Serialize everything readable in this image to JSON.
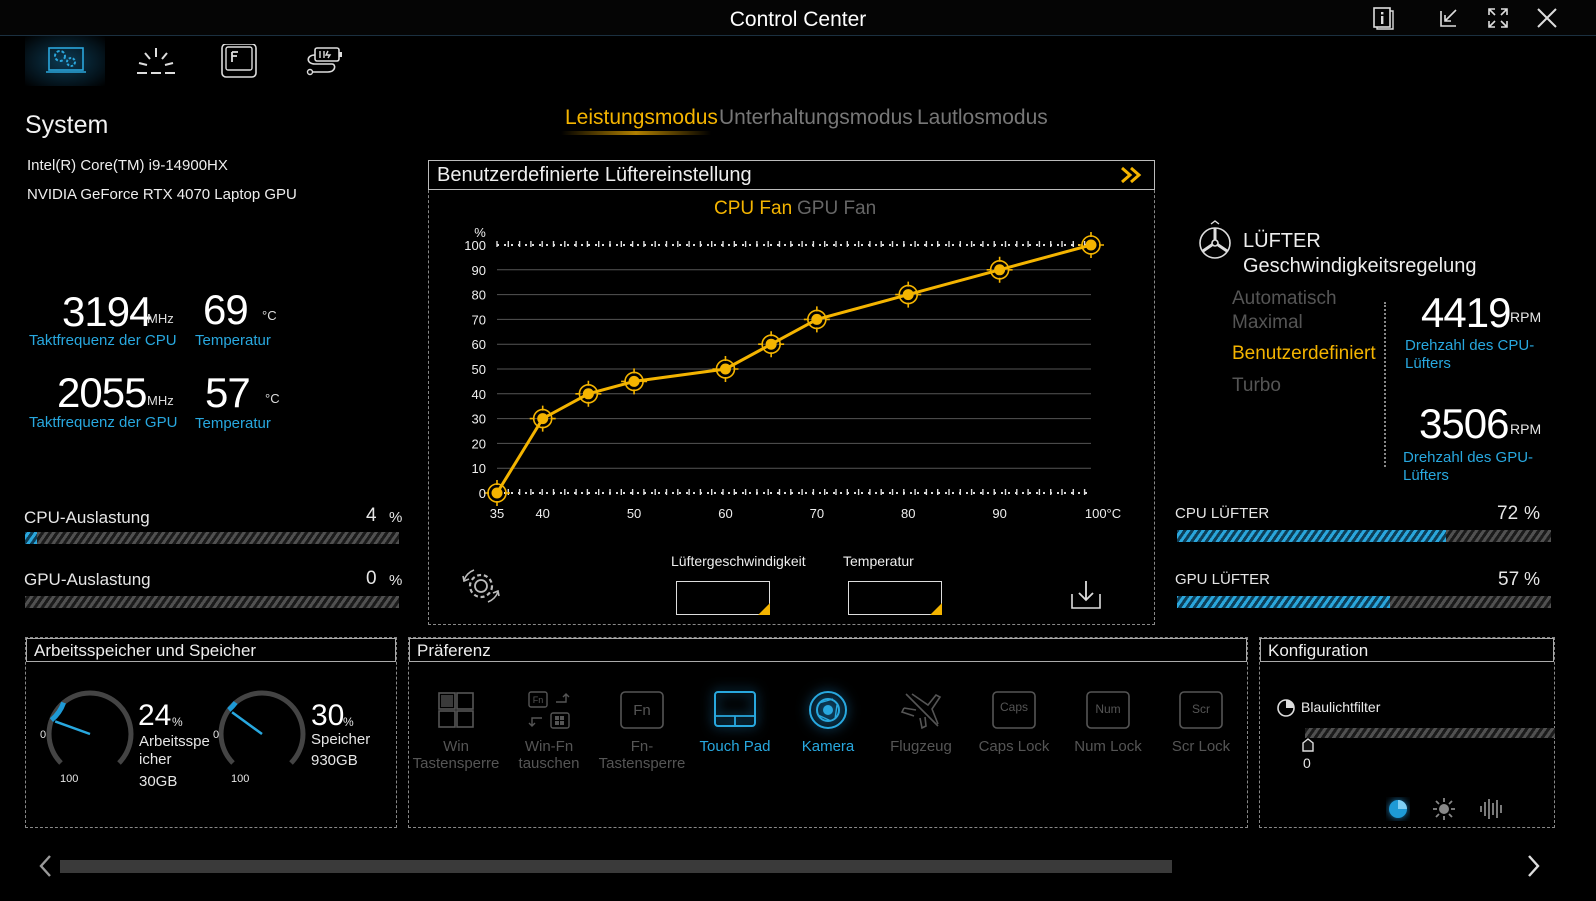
{
  "window": {
    "title": "Control Center"
  },
  "system": {
    "heading": "System",
    "cpu_name": "Intel(R) Core(TM) i9-14900HX",
    "gpu_name": "NVIDIA GeForce RTX 4070 Laptop GPU",
    "cpu_freq": "3194",
    "cpu_freq_unit": "MHz",
    "cpu_freq_label": "Taktfrequenz der CPU",
    "cpu_temp": "69",
    "temp_unit": "°C",
    "cpu_temp_label": "Temperatur",
    "gpu_freq": "2055",
    "gpu_freq_unit": "MHz",
    "gpu_freq_label": "Taktfrequenz der GPU",
    "gpu_temp": "57",
    "gpu_temp_label": "Temperatur",
    "cpu_load_label": "CPU-Auslastung",
    "cpu_load_value": "4",
    "cpu_load_pct": 4,
    "gpu_load_label": "GPU-Auslastung",
    "gpu_load_value": "0",
    "gpu_load_pct": 0,
    "pct": "%"
  },
  "modes": {
    "items": [
      "Leistungsmodus",
      "Unterhaltungsmodus",
      "Lautlosmodus"
    ],
    "active": 0
  },
  "fan_curve": {
    "title": "Benutzerdefinierte Lüftereinstellung",
    "tabs": [
      "CPU Fan",
      "GPU Fan"
    ],
    "active_tab": 0,
    "speed_label": "Lüftergeschwindigkeit",
    "temp_label": "Temperatur"
  },
  "chart_data": {
    "type": "line",
    "ylabel": "%",
    "xlabel": "",
    "x_ticks": [
      "35",
      "40",
      "50",
      "60",
      "70",
      "80",
      "90",
      "100°C"
    ],
    "x_tick_values": [
      35,
      40,
      50,
      60,
      70,
      80,
      90,
      100
    ],
    "y_ticks": [
      0,
      10,
      20,
      30,
      40,
      50,
      60,
      70,
      80,
      90,
      100
    ],
    "xlim": [
      35,
      100
    ],
    "ylim": [
      0,
      100
    ],
    "series": [
      {
        "x": [
          35,
          40,
          45,
          50,
          60,
          65,
          70,
          80,
          90,
          100
        ],
        "y": [
          0,
          30,
          40,
          45,
          50,
          60,
          70,
          80,
          90,
          100
        ]
      }
    ],
    "color": "#f4b400"
  },
  "fan_control": {
    "heading_line1": "LÜFTER",
    "heading_line2": "Geschwindigkeitsregelung",
    "modes": [
      "Automatisch",
      "Maximal",
      "Benutzerdefiniert",
      "Turbo"
    ],
    "active_mode": 2,
    "cpu_rpm": "4419",
    "rpm_unit": "RPM",
    "cpu_rpm_label_1": "Drehzahl des CPU-",
    "cpu_rpm_label_2": "Lüfters",
    "gpu_rpm": "3506",
    "gpu_rpm_label_1": "Drehzahl des GPU-",
    "gpu_rpm_label_2": "Lüfters",
    "cpu_fan_label": "CPU LÜFTER",
    "cpu_fan_value": "72",
    "cpu_fan_pct": 72,
    "gpu_fan_label": "GPU LÜFTER",
    "gpu_fan_value": "57",
    "gpu_fan_pct": 57,
    "pct": "%"
  },
  "memory": {
    "heading": "Arbeitsspeicher und Speicher",
    "ram_pct": "24",
    "ram_value": 24,
    "ram_label_1": "Arbeitsspe",
    "ram_label_2": "icher",
    "ram_size": "30GB",
    "disk_pct": "30",
    "disk_value": 30,
    "disk_label": "Speicher",
    "disk_size": "930GB",
    "gauge_min": "0",
    "gauge_max": "100",
    "pct": "%"
  },
  "preference": {
    "heading": "Präferenz",
    "items": [
      {
        "l1": "Win",
        "l2": "Tastensperre"
      },
      {
        "l1": "Win-Fn",
        "l2": "tauschen"
      },
      {
        "l1": "Fn-",
        "l2": "Tastensperre"
      },
      {
        "l1": "Touch Pad",
        "l2": ""
      },
      {
        "l1": "Kamera",
        "l2": ""
      },
      {
        "l1": "Flugzeug",
        "l2": ""
      },
      {
        "l1": "Caps Lock",
        "l2": ""
      },
      {
        "l1": "Num Lock",
        "l2": ""
      },
      {
        "l1": "Scr Lock",
        "l2": ""
      }
    ],
    "key_caps": {
      "fn": "Fn",
      "fn_small": "Fn",
      "caps": "Caps",
      "num": "Num",
      "scr": "Scr"
    }
  },
  "config": {
    "heading": "Konfiguration",
    "bluelight_label": "Blaulichtfilter",
    "bluelight_value": "0",
    "bluelight_level": 0
  },
  "colors": {
    "accent_blue": "#28a8df",
    "accent_orange": "#f4b400",
    "inactive": "#555555"
  }
}
